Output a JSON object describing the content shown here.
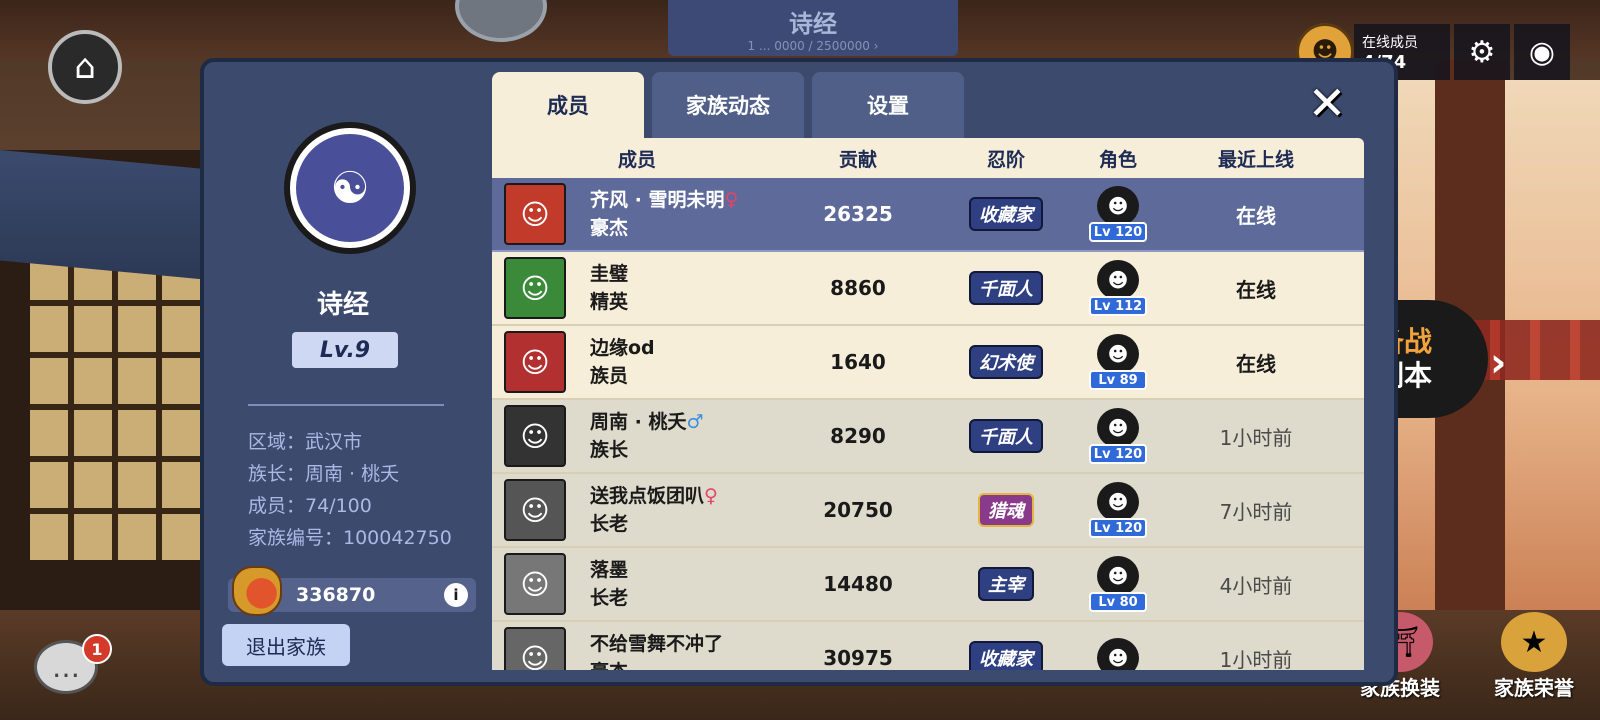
{
  "top_banner": {
    "title": "诗经",
    "subtitle": "1 ... 0000 / 2500000 ›"
  },
  "hud": {
    "online_label": "在线成员",
    "online_value": "4/74"
  },
  "family": {
    "name": "诗经",
    "level": "Lv.9",
    "region": "区域：武汉市",
    "leader": "族长：周南 · 桃夭",
    "members": "成员：74/100",
    "family_id": "家族编号：100042750",
    "coins": "336870",
    "quit_label": "退出家族"
  },
  "tabs": [
    {
      "label": "成员",
      "active": true
    },
    {
      "label": "家族动态",
      "active": false
    },
    {
      "label": "设置",
      "active": false
    }
  ],
  "table": {
    "headers": {
      "member": "成员",
      "contribution": "贡献",
      "rank": "忍阶",
      "role": "角色",
      "last_online": "最近上线"
    },
    "rows": [
      {
        "name": "齐风 · 雪明未明",
        "gender": "♀",
        "title": "豪杰",
        "contribution": "26325",
        "rank": "收藏家",
        "role_level": "Lv 120",
        "last_online": "在线",
        "self": true,
        "online": true,
        "avatar_color": "#c23a2a"
      },
      {
        "name": "圭璧",
        "gender": "",
        "title": "精英",
        "contribution": "8860",
        "rank": "千面人",
        "role_level": "Lv 112",
        "last_online": "在线",
        "self": false,
        "online": true,
        "avatar_color": "#3a8a3a"
      },
      {
        "name": "边缘od",
        "gender": "",
        "title": "族员",
        "contribution": "1640",
        "rank": "幻术使",
        "role_level": "Lv 89",
        "last_online": "在线",
        "self": false,
        "online": true,
        "avatar_color": "#b23030"
      },
      {
        "name": "周南 · 桃夭",
        "gender": "♂",
        "title": "族长",
        "contribution": "8290",
        "rank": "千面人",
        "role_level": "Lv 120",
        "last_online": "1小时前",
        "self": false,
        "online": false,
        "avatar_color": "#333333"
      },
      {
        "name": "送我点饭团叭",
        "gender": "♀",
        "title": "长老",
        "contribution": "20750",
        "rank": "猎魂",
        "role_level": "Lv 120",
        "last_online": "7小时前",
        "self": false,
        "online": false,
        "avatar_color": "#555555"
      },
      {
        "name": "落墨",
        "gender": "",
        "title": "长老",
        "contribution": "14480",
        "rank": "主宰",
        "role_level": "Lv 80",
        "last_online": "4小时前",
        "self": false,
        "online": false,
        "avatar_color": "#777777"
      },
      {
        "name": "不给雪舞不冲了",
        "gender": "",
        "title": "豪杰",
        "contribution": "30975",
        "rank": "收藏家",
        "role_level": "",
        "last_online": "1小时前",
        "self": false,
        "online": false,
        "avatar_color": "#666666"
      }
    ]
  },
  "side_buttons": {
    "battle_line1": "备战",
    "battle_line2": "副本",
    "outfit_label": "家族换装",
    "honor_label": "家族荣誉"
  },
  "chat": {
    "badge": "1"
  }
}
